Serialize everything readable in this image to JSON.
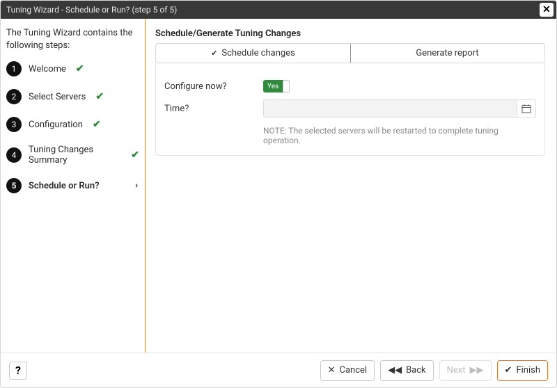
{
  "title": "Tuning Wizard - Schedule or Run? (step 5 of 5)",
  "sidebar": {
    "intro": "The Tuning Wizard contains the following steps:",
    "steps": [
      {
        "num": "1",
        "label": "Welcome",
        "done": true,
        "active": false
      },
      {
        "num": "2",
        "label": "Select Servers",
        "done": true,
        "active": false
      },
      {
        "num": "3",
        "label": "Configuration",
        "done": true,
        "active": false
      },
      {
        "num": "4",
        "label": "Tuning Changes Summary",
        "done": true,
        "active": false
      },
      {
        "num": "5",
        "label": "Schedule or Run?",
        "done": false,
        "active": true
      }
    ]
  },
  "main": {
    "panel_title": "Schedule/Generate Tuning Changes",
    "tabs": {
      "schedule": "Schedule changes",
      "report": "Generate report"
    },
    "configure_label": "Configure now?",
    "switch_text": "Yes",
    "time_label": "Time?",
    "time_value": "",
    "note": "NOTE: The selected servers will be restarted to complete tuning operation."
  },
  "footer": {
    "help": "?",
    "cancel": "Cancel",
    "back": "Back",
    "next": "Next",
    "finish": "Finish"
  }
}
